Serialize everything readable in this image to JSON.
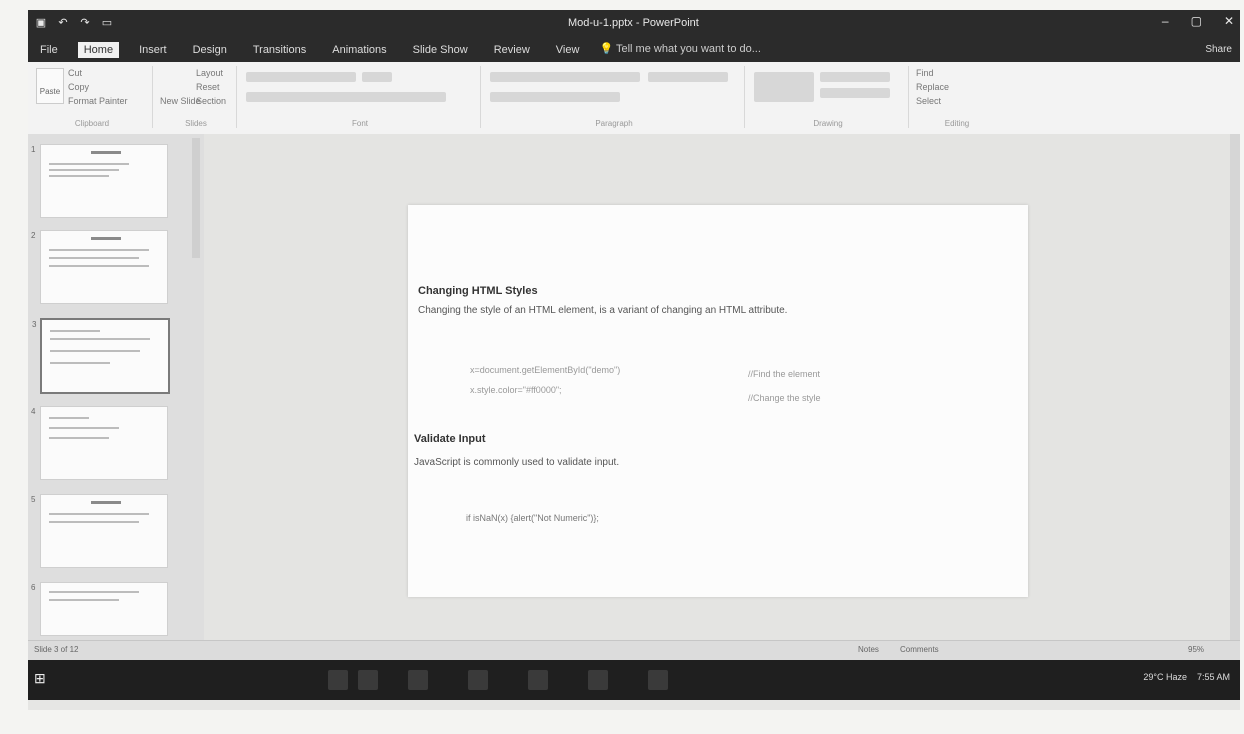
{
  "window": {
    "title": "Mod-u-1.pptx - PowerPoint"
  },
  "quick_access": {
    "save_icon": "save-icon",
    "undo_icon": "undo-icon",
    "redo_icon": "redo-icon",
    "present_icon": "present-icon"
  },
  "ribbon": {
    "tabs": [
      "File",
      "Home",
      "Insert",
      "Design",
      "Transitions",
      "Animations",
      "Slide Show",
      "Review",
      "View"
    ],
    "active_tab": "Home",
    "tell_me": "Tell me what you want to do...",
    "user": "Share",
    "groups": [
      "Clipboard",
      "Slides",
      "Font",
      "Paragraph",
      "Drawing",
      "Editing"
    ],
    "clipboard": {
      "paste": "Paste",
      "cut": "Cut",
      "copy": "Copy",
      "format_painter": "Format Painter"
    },
    "slides": {
      "new_slide": "New Slide",
      "layout": "Layout",
      "reset": "Reset",
      "section": "Section"
    },
    "editing": {
      "find": "Find",
      "replace": "Replace",
      "select": "Select"
    }
  },
  "slide": {
    "heading1": "Changing HTML Styles",
    "text1": "Changing the style of an HTML element, is a variant of changing an HTML attribute.",
    "code1a": "x=document.getElementById(\"demo\")",
    "comment1a": "//Find the element",
    "code1b": "x.style.color=\"#ff0000\";",
    "comment1b": "//Change the style",
    "heading2": "Validate Input",
    "text2": "JavaScript is commonly used to validate input.",
    "code2": "if isNaN(x) {alert(\"Not Numeric\")};"
  },
  "slide_panel": {
    "numbers": [
      "1",
      "2",
      "3",
      "4",
      "5",
      "6"
    ]
  },
  "statusbar": {
    "slide_info": "Slide 3 of 12",
    "notes": "Notes",
    "comments": "Comments",
    "zoom": "95%"
  },
  "taskbar": {
    "weather": "29°C Haze",
    "time": "7:55 AM"
  }
}
